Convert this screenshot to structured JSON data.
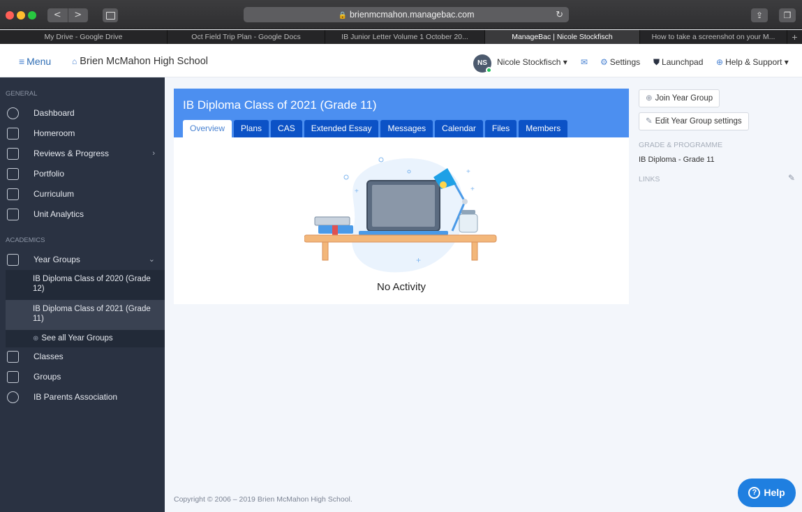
{
  "browser": {
    "url": "brienmcmahon.managebac.com",
    "tabs": [
      "My Drive - Google Drive",
      "Oct Field Trip Plan - Google Docs",
      "IB Junior Letter Volume 1 October 20...",
      "ManageBac | Nicole Stockfisch",
      "How to take a screenshot on your M..."
    ],
    "nav_back": "<",
    "nav_forward": ">",
    "new_tab": "+"
  },
  "topnav": {
    "menu_label": "Menu",
    "school_name": "Brien McMahon High School",
    "avatar_initials": "NS",
    "user_name": "Nicole Stockfisch",
    "settings": "Settings",
    "launchpad": "Launchpad",
    "help_support": "Help & Support"
  },
  "sidebar": {
    "general_label": "GENERAL",
    "general_items": [
      "Dashboard",
      "Homeroom",
      "Reviews & Progress",
      "Portfolio",
      "Curriculum",
      "Unit Analytics"
    ],
    "academics_label": "ACADEMICS",
    "year_groups": "Year Groups",
    "year_group_items": [
      "IB Diploma Class of 2020 (Grade 12)",
      "IB Diploma Class of 2021 (Grade 11)"
    ],
    "see_all": "See all Year Groups",
    "academic_items": [
      "Classes",
      "Groups",
      "IB Parents Association"
    ]
  },
  "main": {
    "title": "IB Diploma Class of 2021 (Grade 11)",
    "tabs": [
      "Overview",
      "Plans",
      "CAS",
      "Extended Essay",
      "Messages",
      "Calendar",
      "Files",
      "Members"
    ],
    "active_tab": "Overview",
    "empty_text": "No Activity"
  },
  "right": {
    "join_button": "Join Year Group",
    "edit_button": "Edit Year Group settings",
    "grade_label": "GRADE & PROGRAMME",
    "grade_value": "IB Diploma - Grade 11",
    "links_label": "LINKS"
  },
  "footer": "Copyright © 2006 – 2019 Brien McMahon High School.",
  "help_button": "Help",
  "colors": {
    "primary": "#4c8ff0",
    "tab": "#0c52c6",
    "sidebar": "#2a3242",
    "help": "#1f7fe0"
  }
}
